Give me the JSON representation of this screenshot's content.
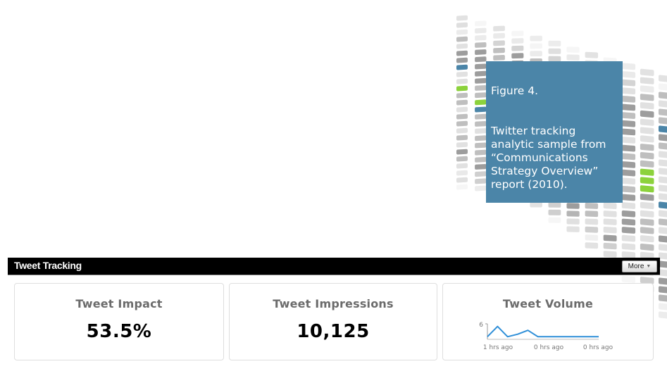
{
  "figure": {
    "title": "Figure 4.",
    "caption_lines": [
      "Twitter tracking",
      "analytic sample from",
      "“Communications",
      "Strategy Overview”",
      "report (2010)."
    ],
    "background_color": "#4b85a8"
  },
  "header": {
    "title": "Tweet Tracking",
    "more_button_label": "More",
    "more_button_icon": "caret-down-icon"
  },
  "cards": {
    "impact": {
      "title": "Tweet Impact",
      "value": "53.5%"
    },
    "impressions": {
      "title": "Tweet Impressions",
      "value": "10,125"
    },
    "volume": {
      "title": "Tweet Volume"
    }
  },
  "chart_data": {
    "type": "line",
    "title": "Tweet Volume",
    "xlabel": "",
    "ylabel": "",
    "ylim": [
      0,
      6
    ],
    "y_ticks": [
      "6"
    ],
    "x_tick_labels": [
      "1 hrs ago",
      "0 hrs ago",
      "0 hrs ago"
    ],
    "series": [
      {
        "name": "Tweet Volume",
        "color": "#2f8fd8",
        "values": [
          1,
          5,
          1,
          2,
          3.5,
          1,
          1,
          1,
          1,
          1,
          1,
          1
        ]
      }
    ],
    "grid": false,
    "legend": "none"
  },
  "decor": {
    "accent_colors": {
      "blue": "#4b85a8",
      "green": "#8cd23c",
      "gray_dark": "#8c8c8c",
      "gray_mid": "#b4b4b4",
      "gray_light": "#dcdcdc"
    }
  }
}
